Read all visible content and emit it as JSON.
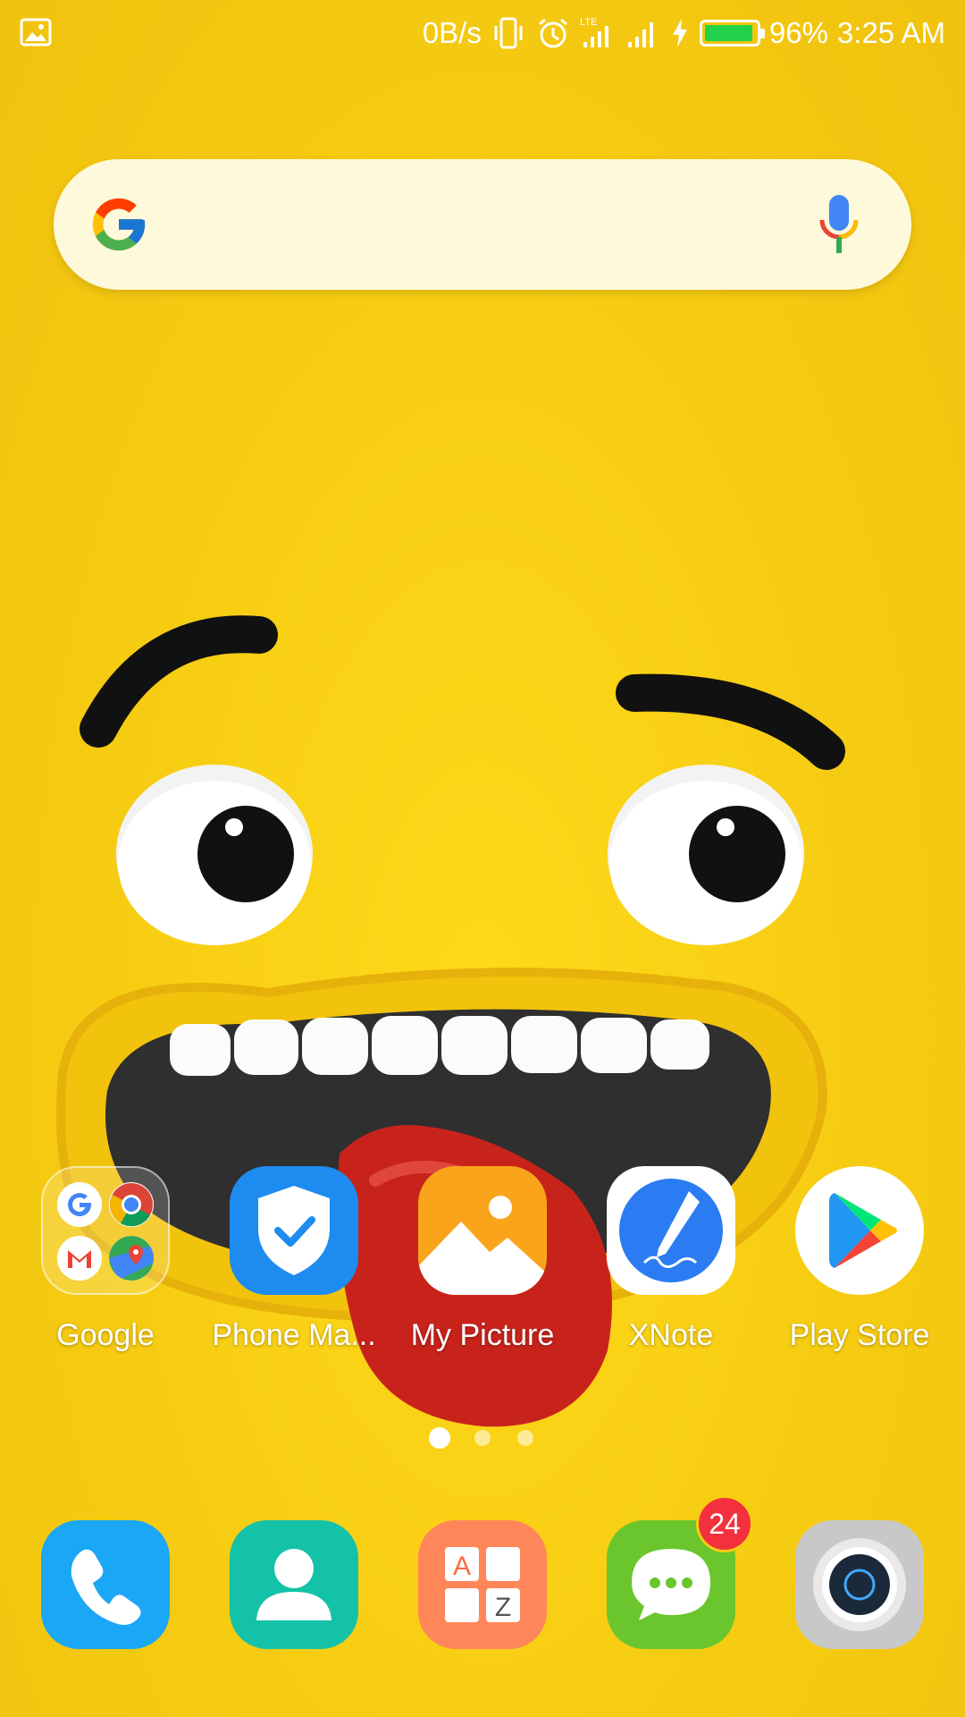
{
  "status_bar": {
    "network_speed": "0B/s",
    "battery_percent": "96%",
    "battery_level": 0.96,
    "time": "3:25 AM",
    "network_type": "LTE",
    "icons": [
      "gallery-icon",
      "vibrate-icon",
      "alarm-icon",
      "lte-signal-icon",
      "signal-icon",
      "charging-icon",
      "battery-icon"
    ]
  },
  "search_bar": {
    "logo": "google-g-icon",
    "mic_icon": "mic-icon"
  },
  "apps": [
    {
      "label": "Google",
      "icon": "google-folder-icon"
    },
    {
      "label": "Phone Ma...",
      "icon": "phone-manager-shield-icon"
    },
    {
      "label": "My Picture",
      "icon": "gallery-picture-icon"
    },
    {
      "label": "XNote",
      "icon": "xnote-pen-icon"
    },
    {
      "label": "Play Store",
      "icon": "play-store-icon"
    }
  ],
  "folder_apps": [
    "google-icon",
    "chrome-icon",
    "gmail-icon",
    "maps-icon"
  ],
  "page_indicator": {
    "pages": 3,
    "current": 1
  },
  "dock": [
    {
      "name": "phone",
      "icon": "phone-icon",
      "color": "#1aa7f5"
    },
    {
      "name": "contacts",
      "icon": "contacts-icon",
      "color": "#14c2a8"
    },
    {
      "name": "app-drawer",
      "icon": "app-drawer-az-icon",
      "color": "#ff8659"
    },
    {
      "name": "messages",
      "icon": "messages-icon",
      "color": "#6ac62c",
      "badge": "24"
    },
    {
      "name": "camera",
      "icon": "camera-icon",
      "color": "#c8c8c8"
    }
  ]
}
